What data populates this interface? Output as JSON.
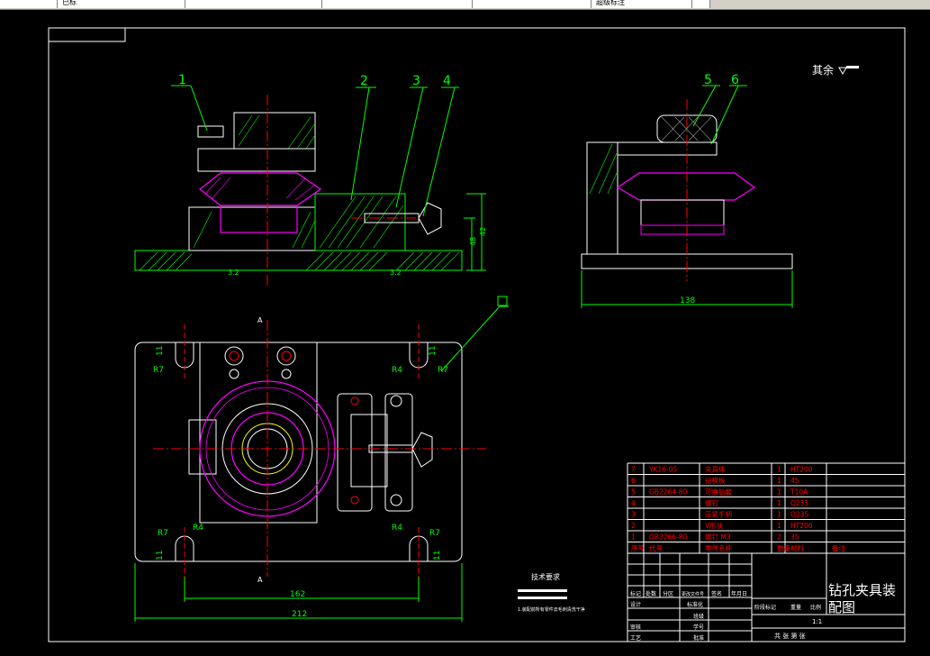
{
  "toolbar": {
    "segments": [
      "",
      "已标",
      "",
      "",
      "",
      "",
      "超级标注",
      ""
    ]
  },
  "drawing": {
    "roughness_note": "其余",
    "callouts": [
      "1",
      "2",
      "3",
      "4",
      "5",
      "6"
    ],
    "dims": {
      "front_height": "48",
      "front_height2": "42",
      "side_width": "138",
      "top_inner_width": "162",
      "top_overall_width": "212",
      "r7": "R7",
      "r4": "R4",
      "eleven": "11",
      "roughness_a": "3.2",
      "roughness_b": "3.2",
      "section_a": "A"
    }
  },
  "bom": {
    "rows": [
      {
        "no": "7",
        "code": "YK16-05",
        "name": "夹具体",
        "qty": "1",
        "mat": "HT200",
        "note": ""
      },
      {
        "no": "6",
        "code": "",
        "name": "钻模板",
        "qty": "1",
        "mat": "45",
        "note": ""
      },
      {
        "no": "5",
        "code": "GB2264-80",
        "name": "可换钻套",
        "qty": "1",
        "mat": "T10A",
        "note": ""
      },
      {
        "no": "4",
        "code": "",
        "name": "螺钉",
        "qty": "1",
        "mat": "Q235",
        "note": ""
      },
      {
        "no": "3",
        "code": "",
        "name": "压紧手柄",
        "qty": "1",
        "mat": "Q235",
        "note": ""
      },
      {
        "no": "2",
        "code": "",
        "name": "V形块",
        "qty": "1",
        "mat": "HT200",
        "note": ""
      },
      {
        "no": "1",
        "code": "GB2266-80",
        "name": "螺钉 M3",
        "qty": "2",
        "mat": "35",
        "note": ""
      }
    ],
    "header": {
      "no": "序号",
      "code": "代号",
      "name": "零件名称",
      "qty": "数量",
      "mat": "材料",
      "note": "备注"
    }
  },
  "title_block": {
    "title_line1": "钻孔夹具装",
    "title_line2": "配图",
    "labels": {
      "mark": "标记",
      "count": "处数",
      "zone": "分区",
      "change_doc": "更改文件号",
      "sign": "签名",
      "date": "年月日",
      "design": "设计",
      "standard": "标准化",
      "review": "审核",
      "process": "工艺",
      "approve": "批准",
      "class": "班级",
      "student_no": "学号",
      "stage": "阶段标记",
      "weight": "重量",
      "scale": "比例",
      "scale_val": "1:1",
      "sheets": "共 张 第 张"
    }
  },
  "notes": {
    "heading": "技术要求",
    "line": "1.装配前所有零件去毛刺清洗干净"
  }
}
